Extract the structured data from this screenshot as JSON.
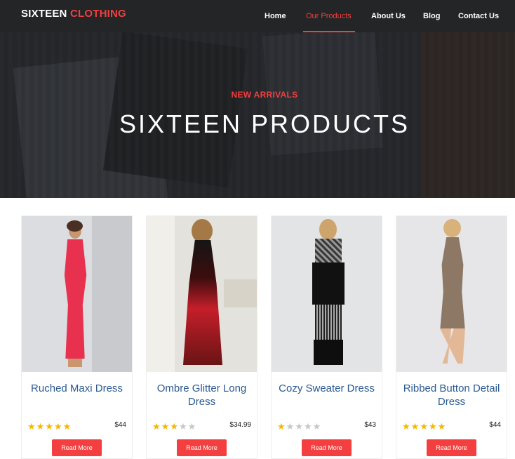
{
  "brand": {
    "part1": "SIXTEEN",
    "part2": "CLOTHING",
    "accent_color": "#f33f3f"
  },
  "nav": {
    "items": [
      {
        "label": "Home",
        "active": false
      },
      {
        "label": "Our Products",
        "active": true
      },
      {
        "label": "About Us",
        "active": false
      },
      {
        "label": "Blog",
        "active": false
      },
      {
        "label": "Contact Us",
        "active": false
      }
    ]
  },
  "hero": {
    "subtitle": "NEW ARRIVALS",
    "title": "SIXTEEN PRODUCTS"
  },
  "products": [
    {
      "title": "Ruched Maxi Dress",
      "rating": 5,
      "price": "$44",
      "button": "Read More",
      "dress_color": "#e8304f",
      "image": "pink-maxi-dress"
    },
    {
      "title": "Ombre Glitter Long Dress",
      "rating": 3,
      "price": "$34.99",
      "button": "Read More",
      "dress_color": "#8c1515",
      "image": "red-ombre-dress"
    },
    {
      "title": "Cozy Sweater Dress",
      "rating": 1,
      "price": "$43",
      "button": "Read More",
      "dress_color": "#1a1a1a",
      "image": "black-sweater-dress"
    },
    {
      "title": "Ribbed Button Detail Dress",
      "rating": 5,
      "price": "$44",
      "button": "Read More",
      "dress_color": "#8d7765",
      "image": "taupe-ribbed-dress"
    }
  ]
}
